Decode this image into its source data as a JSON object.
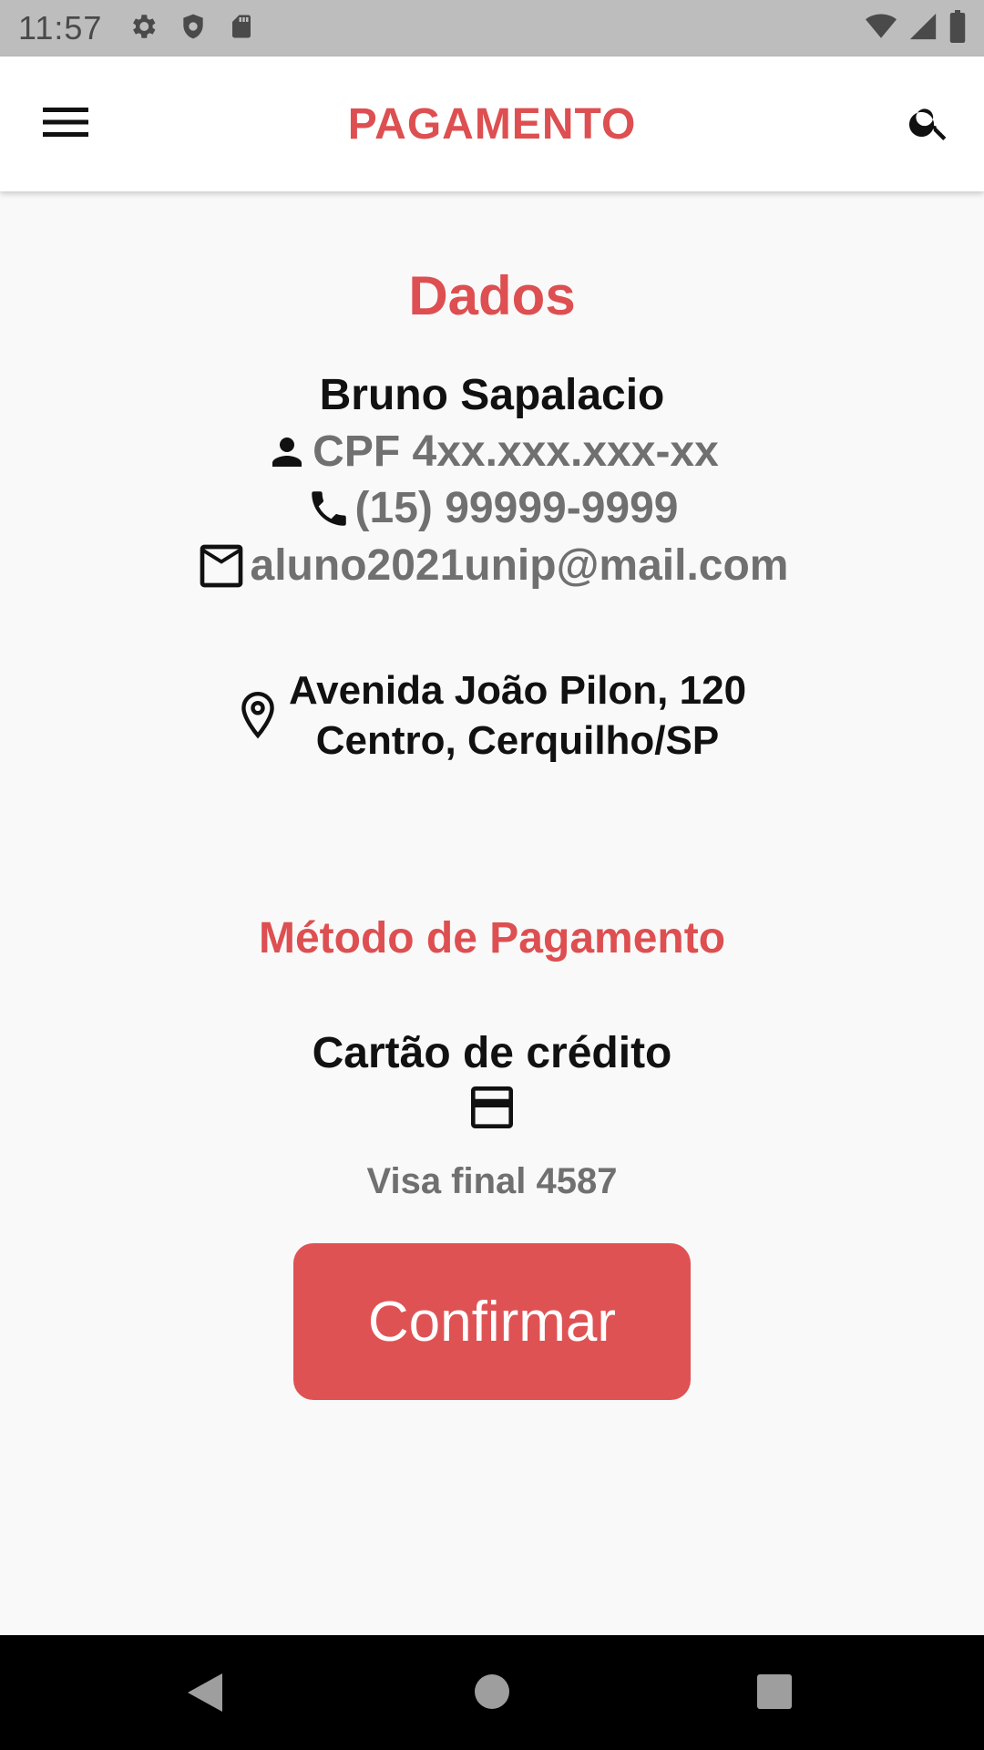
{
  "status_bar": {
    "time": "11:57",
    "icons": [
      "settings-gear-icon",
      "shield-icon",
      "sd-card-icon",
      "wifi-icon",
      "signal-icon",
      "battery-icon"
    ]
  },
  "app_bar": {
    "title": "PAGAMENTO",
    "menu_icon": "hamburger-menu-icon",
    "search_icon": "search-icon"
  },
  "dados": {
    "title": "Dados",
    "name": "Bruno Sapalacio",
    "cpf": "CPF 4xx.xxx.xxx-xx",
    "phone": "(15) 99999-9999",
    "email": "aluno2021unip@mail.com",
    "address_line1": "Avenida João Pilon, 120",
    "address_line2": "Centro, Cerquilho/SP"
  },
  "metodo": {
    "title": "Método de Pagamento",
    "type": "Cartão de crédito",
    "card_final": "Visa final 4587"
  },
  "confirm_button_label": "Confirmar",
  "colors": {
    "accent": "#dd4f51",
    "button": "#df5254",
    "status_bar": "#bdbdbd",
    "background": "#f9f9f9"
  }
}
